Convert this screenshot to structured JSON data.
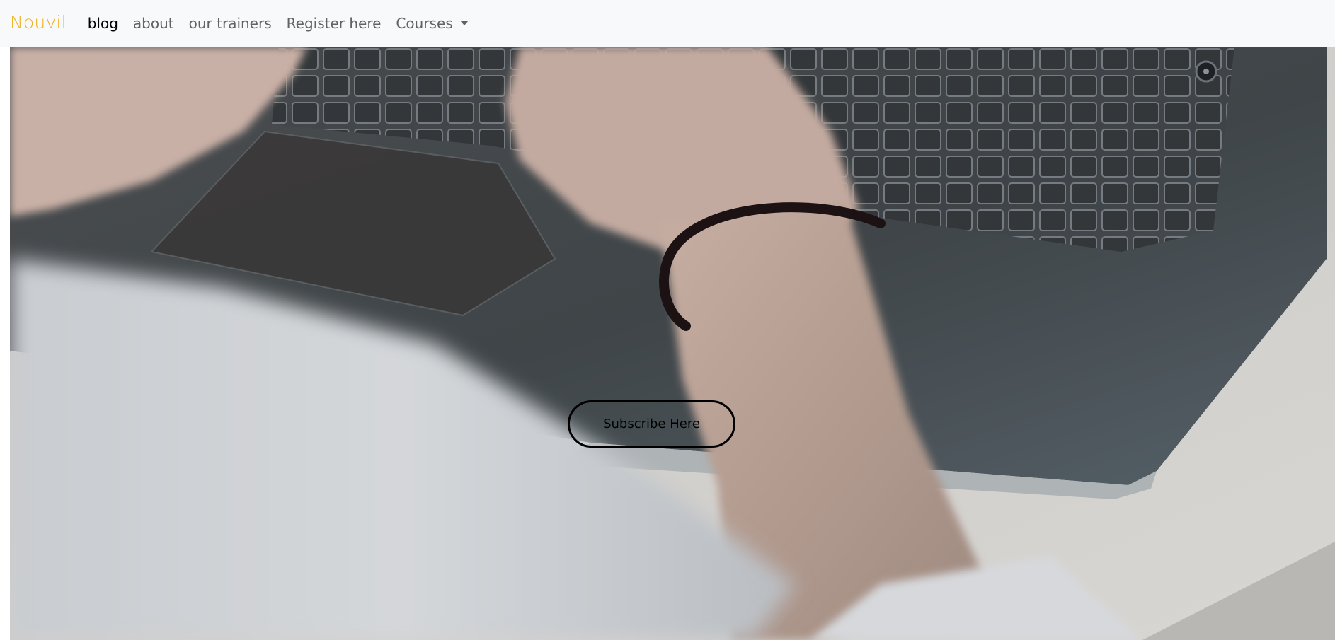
{
  "navbar": {
    "brand": "Nouvil",
    "brand_color": "#f0b323",
    "links": [
      {
        "label": "blog",
        "active": true
      },
      {
        "label": "about",
        "active": false
      },
      {
        "label": "our trainers",
        "active": false
      },
      {
        "label": "Register here",
        "active": false
      },
      {
        "label": "Courses",
        "active": false,
        "dropdown": true
      }
    ],
    "dropdown_icon": "caret-down-icon"
  },
  "hero": {
    "subscribe_label": "Subscribe Here"
  },
  "colors": {
    "navbar_bg": "#f8f9fa",
    "link_muted": "#5f6367",
    "link_active": "#000000"
  }
}
